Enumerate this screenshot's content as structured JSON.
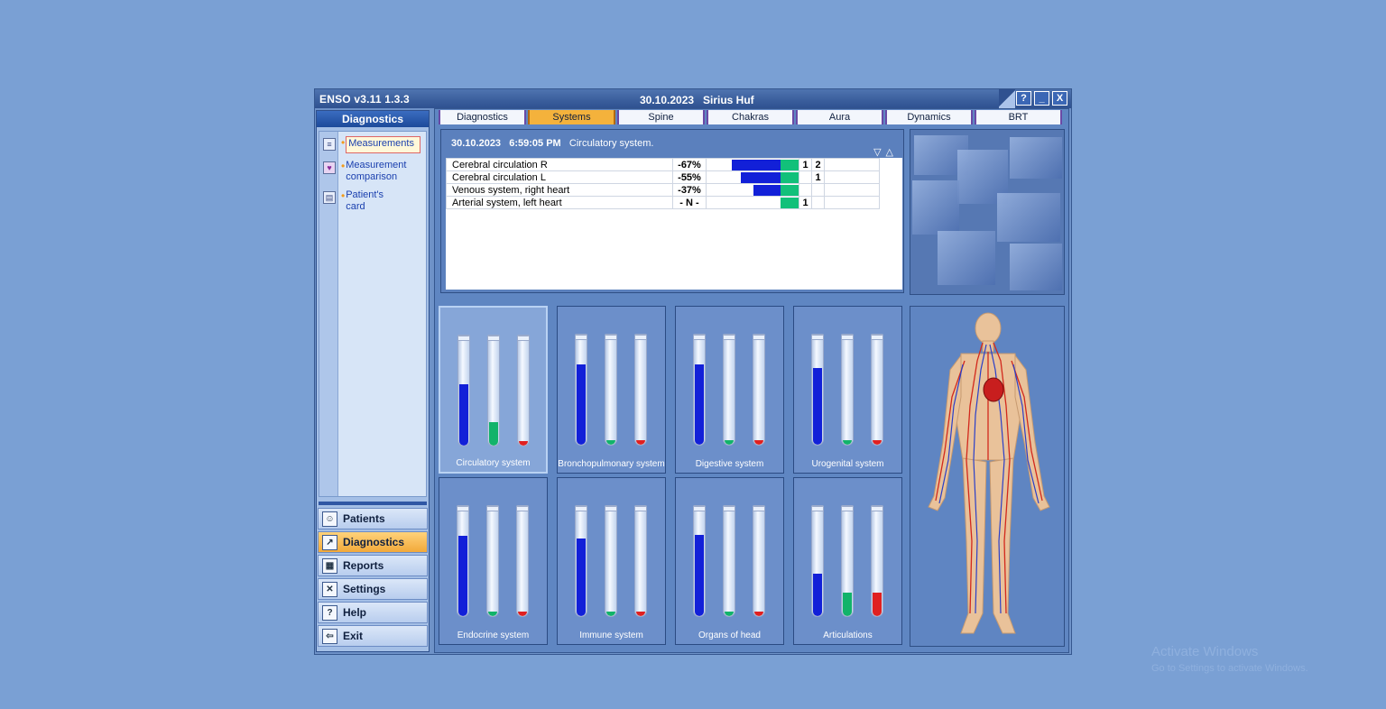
{
  "window": {
    "app_title": "ENSO v3.11  1.3.3",
    "date": "30.10.2023",
    "user": "Sirius  Huf",
    "controls": [
      "?",
      "_",
      "X"
    ]
  },
  "sidebar": {
    "header": "Diagnostics",
    "items": [
      {
        "label": "Measurements",
        "icon": "list-icon",
        "active": true
      },
      {
        "label": "Measurement comparison",
        "icon": "lungs-icon",
        "active": false
      },
      {
        "label": "Patient's card",
        "icon": "card-icon",
        "active": false
      }
    ],
    "nav": [
      {
        "label": "Patients",
        "icon": "patients-icon"
      },
      {
        "label": "Diagnostics",
        "icon": "diagnostics-icon",
        "active": true
      },
      {
        "label": "Reports",
        "icon": "reports-icon"
      },
      {
        "label": "Settings",
        "icon": "settings-icon"
      },
      {
        "label": "Help",
        "icon": "help-icon"
      },
      {
        "label": "Exit",
        "icon": "exit-icon"
      }
    ]
  },
  "tabs": [
    {
      "label": "Diagnostics"
    },
    {
      "label": "Systems",
      "active": true
    },
    {
      "label": "Spine"
    },
    {
      "label": "Chakras"
    },
    {
      "label": "Aura"
    },
    {
      "label": "Dynamics"
    },
    {
      "label": "BRT"
    }
  ],
  "measurement": {
    "date": "30.10.2023",
    "time": "6:59:05 PM",
    "subject": "Circulatory system.",
    "sort_down": "▽",
    "sort_up": "△",
    "rows": [
      {
        "name": "Cerebral circulation R",
        "pct": "-67%",
        "level": 0.67,
        "c1": "1",
        "c2": "2"
      },
      {
        "name": "Cerebral circulation L",
        "pct": "-55%",
        "level": 0.55,
        "c1": "",
        "c2": "1"
      },
      {
        "name": "Venous system, right heart",
        "pct": "-37%",
        "level": 0.37,
        "c1": "",
        "c2": ""
      },
      {
        "name": "Arterial system, left heart",
        "pct": "- N -",
        "level": 0,
        "c1": "1",
        "c2": ""
      }
    ]
  },
  "systems": [
    {
      "label": "Circulatory system",
      "blue": 0.58,
      "green": 0.22,
      "red": 0.04,
      "selected": true
    },
    {
      "label": "Bronchopulmonary system",
      "blue": 0.75,
      "green": 0.04,
      "red": 0.04
    },
    {
      "label": "Digestive system",
      "blue": 0.75,
      "green": 0.04,
      "red": 0.04
    },
    {
      "label": "Urogenital system",
      "blue": 0.72,
      "green": 0.04,
      "red": 0.04
    },
    {
      "label": "Endocrine system",
      "blue": 0.75,
      "green": 0.04,
      "red": 0.04
    },
    {
      "label": "Immune system",
      "blue": 0.73,
      "green": 0.04,
      "red": 0.04
    },
    {
      "label": "Organs of head",
      "blue": 0.76,
      "green": 0.04,
      "red": 0.04
    },
    {
      "label": "Articulations",
      "blue": 0.4,
      "green": 0.22,
      "red": 0.22
    }
  ],
  "colors": {
    "blue": "#1220d8",
    "green": "#12b36a",
    "red": "#e02020",
    "accent": "#f4b23c"
  },
  "watermark": {
    "title": "Activate Windows",
    "subtitle": "Go to Settings to activate Windows."
  }
}
